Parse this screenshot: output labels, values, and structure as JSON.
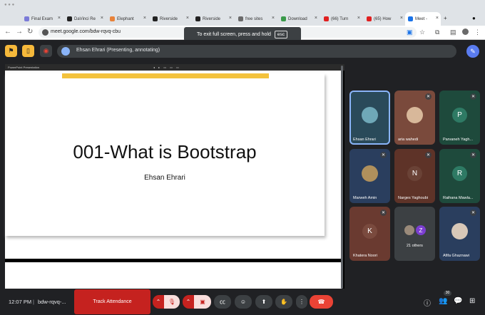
{
  "browser": {
    "tabs": [
      {
        "label": "Final Exam",
        "color": "#7b7bd8"
      },
      {
        "label": "DaVinci Re",
        "color": "#222222"
      },
      {
        "label": "Elephant",
        "color": "#e8823a"
      },
      {
        "label": "Riverside",
        "color": "#222222"
      },
      {
        "label": "Riverside",
        "color": "#222222"
      },
      {
        "label": "free sites",
        "color": "#6a6a6a"
      },
      {
        "label": "Download",
        "color": "#3a9a4a"
      },
      {
        "label": "(66) Turn",
        "color": "#e02020"
      },
      {
        "label": "(65) How",
        "color": "#e02020"
      },
      {
        "label": "Meet - ",
        "color": "#1a73e8"
      }
    ],
    "new_tab": "+",
    "url": "meet.google.com/bdw-rqvq-cbu",
    "toast_text": "To exit full screen, press and hold",
    "toast_key": "esc"
  },
  "meet": {
    "presenter_label": "Ehsan Ehrari (Presenting, annotating)",
    "slide": {
      "app_title": "PowerPoint Presentation",
      "title": "001-What is Bootstrap",
      "subtitle": "Ehsan Ehrari",
      "accent_color": "#f3c23c"
    },
    "participants": [
      {
        "name": "Ehsan Ehrari",
        "initial": "",
        "bg": "#2a4a5a",
        "avatar_color": "#6fa8b8",
        "muted": false,
        "active": true
      },
      {
        "name": "aria wahedi",
        "initial": "",
        "bg": "#7a4a3c",
        "avatar_color": "#d8b89a",
        "muted": true,
        "active": false
      },
      {
        "name": "Parvaneh Yagh...",
        "initial": "P",
        "bg": "#1e4a3c",
        "avatar_color": "#2e7a64",
        "muted": true,
        "active": false
      },
      {
        "name": "Marweh Amin",
        "initial": "",
        "bg": "#2a3e5e",
        "avatar_color": "#b0905c",
        "muted": true,
        "active": false
      },
      {
        "name": "Narges Yaghoubi",
        "initial": "N",
        "bg": "#5e3328",
        "avatar_color": "#6a4236",
        "muted": true,
        "active": false
      },
      {
        "name": "Raihana Mawla...",
        "initial": "R",
        "bg": "#1e4a3c",
        "avatar_color": "#2e7a64",
        "muted": true,
        "active": false
      },
      {
        "name": "Khatera Noori",
        "initial": "K",
        "bg": "#6a3a30",
        "avatar_color": "#7a4a3e",
        "muted": true,
        "active": false
      },
      {
        "name": "21 others",
        "initial": "Z",
        "bg": "#3c4043",
        "avatar_color": "#7b3ed0",
        "muted": false,
        "active": false
      },
      {
        "name": "Afifa Ghaznawi",
        "initial": "",
        "bg": "#2a3e5e",
        "avatar_color": "#d8c8b8",
        "muted": true,
        "active": false
      }
    ],
    "bottom": {
      "time": "12:07 PM",
      "separator": "|",
      "meeting_code": "bdw-rqvq-...",
      "track_label": "Track Attendance",
      "participant_count": "30"
    }
  }
}
